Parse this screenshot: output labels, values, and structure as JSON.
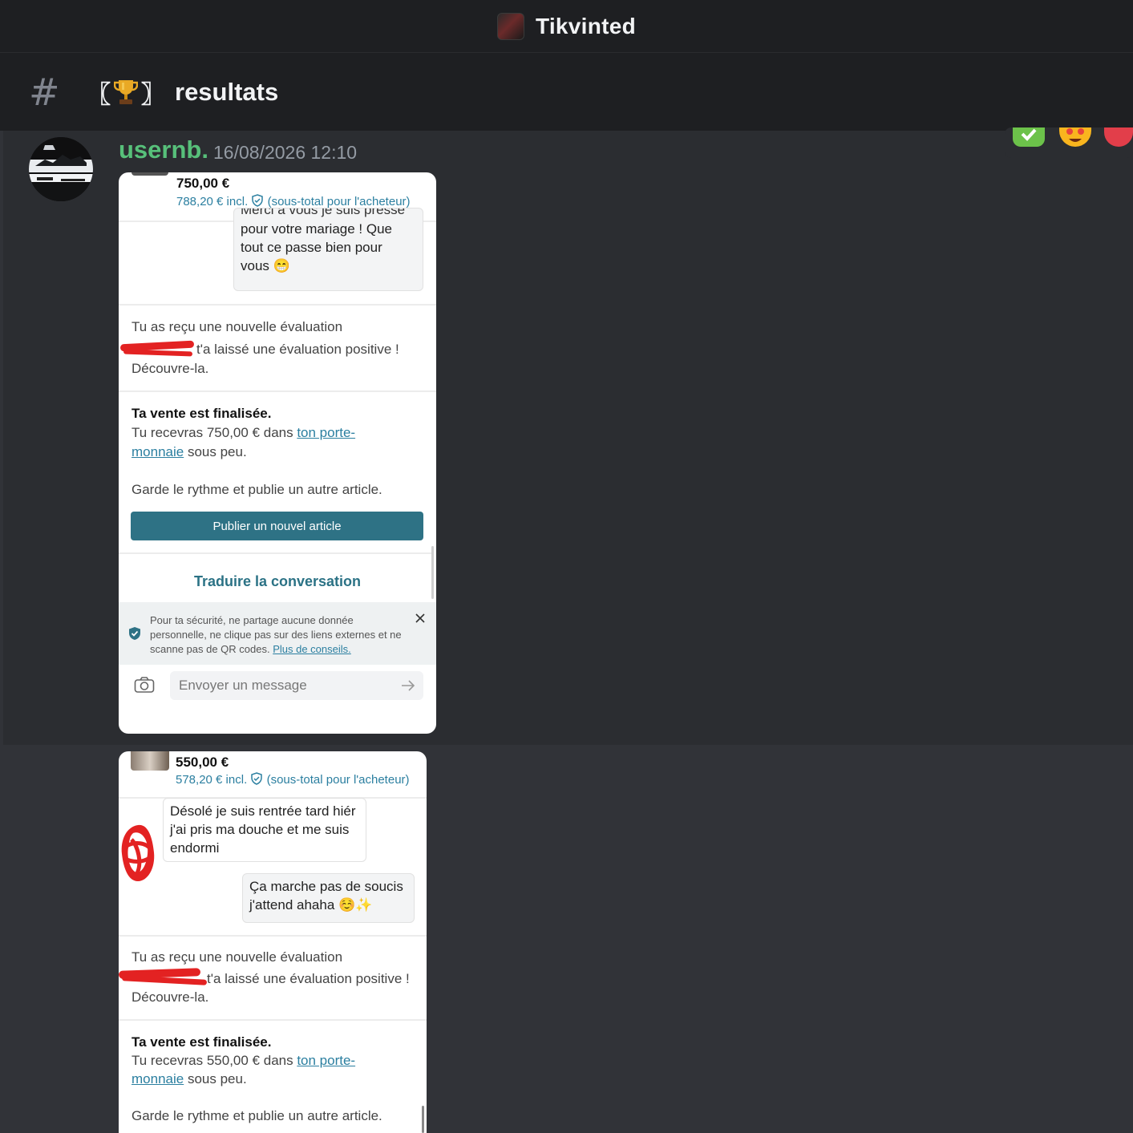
{
  "server": {
    "name": "Tikvinted"
  },
  "channel": {
    "hash": "#",
    "name": "resultats",
    "bracket_left": "〖",
    "bracket_right": "〗"
  },
  "message": {
    "username": "usernb.",
    "timestamp": "16/08/2026 12:10",
    "username_color": "#57c07a"
  },
  "shot1": {
    "price": "750,00 €",
    "subtotal": "788,20 € incl.",
    "subtotal_note": "(sous-total pour l'acheteur)",
    "bubble_top": "Merci à vous je suis pressé",
    "bubble_l1": "pour votre mariage ! Que",
    "bubble_l2": "tout ce passe bien pour",
    "bubble_l3": "vous 😁",
    "eval_title": "Tu as reçu une nouvelle évaluation",
    "eval_line": "t'a laissé une évaluation positive !",
    "eval_cta": "Découvre-la.",
    "sale_title": "Ta vente est finalisée.",
    "sale_l1": "Tu recevras 750,00 € dans ",
    "sale_link1": "ton porte-",
    "sale_link2": "monnaie",
    "sale_l2": " sous peu.",
    "keep": "Garde le rythme et publie un autre article.",
    "publish_btn": "Publier un nouvel article",
    "translate": "Traduire la conversation",
    "security": "Pour ta sécurité, ne partage aucune donnée personnelle, ne clique pas sur des liens externes et ne scanne pas de QR codes. ",
    "security_link": "Plus de conseils.",
    "compose_placeholder": "Envoyer un message"
  },
  "shot2": {
    "price": "550,00 €",
    "subtotal": "578,20 € incl.",
    "subtotal_note": "(sous-total pour l'acheteur)",
    "bubble1_l1": "Désolé je suis rentrée tard hiér",
    "bubble1_l2": "j'ai pris ma douche et me suis",
    "bubble1_l3": "endormi",
    "bubble2_l1": "Ça marche pas de soucis",
    "bubble2_l2": "j'attend ahaha ☺️✨",
    "eval_title": "Tu as reçu une nouvelle évaluation",
    "eval_line": "t'a laissé une évaluation positive !",
    "eval_cta": "Découvre-la.",
    "sale_title": "Ta vente est finalisée.",
    "sale_l1": "Tu recevras 550,00 € dans ",
    "sale_link1": "ton porte-",
    "sale_link2": "monnaie",
    "sale_l2": " sous peu.",
    "keep": "Garde le rythme et publie un autre article."
  },
  "icons": {
    "reactions": [
      "check-mark-reaction",
      "heart-eyes-reaction",
      "heart-reaction"
    ],
    "camera": "camera-icon",
    "send": "send-arrow-icon",
    "shield": "shield-icon",
    "close": "close-icon"
  }
}
